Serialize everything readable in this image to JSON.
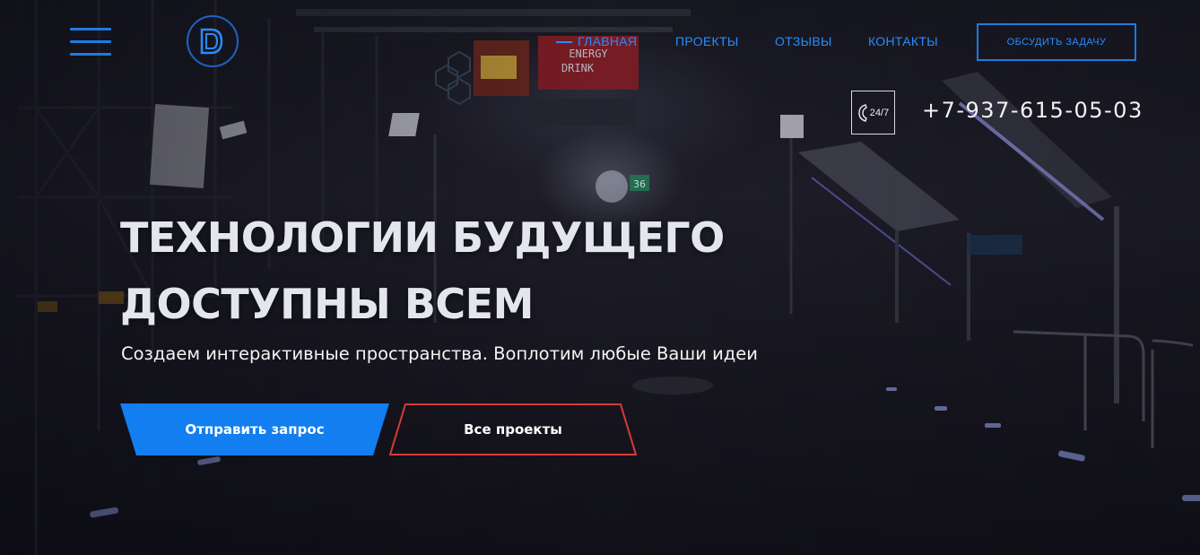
{
  "header": {
    "nav": [
      {
        "label": "ГЛАВНАЯ"
      },
      {
        "label": "ПРОЕКТЫ"
      },
      {
        "label": "ОТЗЫВЫ"
      },
      {
        "label": "КОНТАКТЫ"
      }
    ],
    "cta_label": "ОБСУДИТЬ ЗАДАЧУ",
    "support_label": "24/7",
    "phone": "+7-937-615-05-03",
    "logo_letters": "DD"
  },
  "hero": {
    "headline_line1": "ТЕХНОЛОГИИ БУДУЩЕГО",
    "headline_line2": "ДОСТУПНЫ ВСЕМ",
    "subtitle": "Создаем интерактивные пространства. Воплотим любые Ваши идеи",
    "primary_button": "Отправить запрос",
    "secondary_button": "Все проекты"
  },
  "background": {
    "sign_text_1": "ENERGY",
    "sign_text_2": "DRINK",
    "sign_number": "36"
  },
  "colors": {
    "accent": "#137ef0",
    "nav": "#2a8cff",
    "secondary_border": "#d83a3a",
    "headline": "#e4e6ee"
  }
}
